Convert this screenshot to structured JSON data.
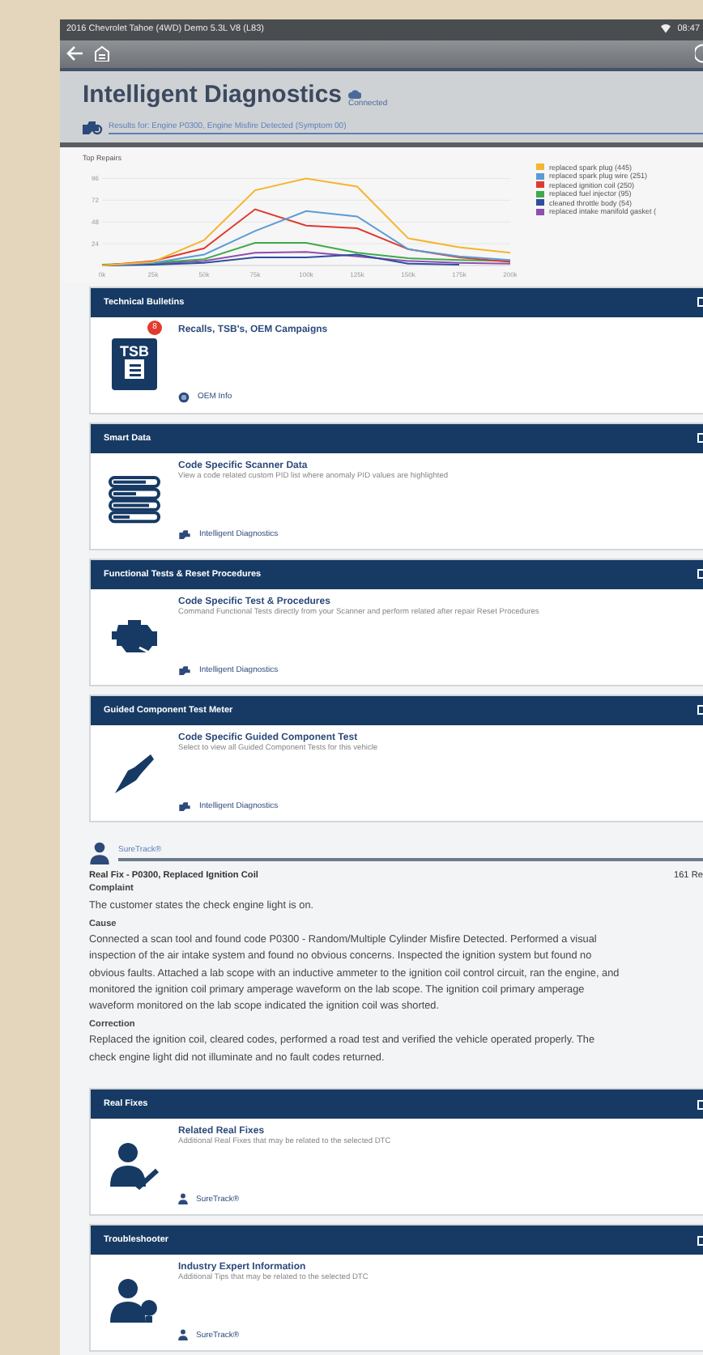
{
  "status_bar": {
    "vehicle": "2016 Chevrolet Tahoe (4WD) Demo 5.3L V8 (L83)",
    "time": "08:47"
  },
  "header": {
    "title": "Intelligent Diagnostics",
    "status": "Connected",
    "results": "Results for: Engine P0300, Engine Misfire Detected (Symptom 00)"
  },
  "chart_data": {
    "type": "line",
    "title": "Top Repairs",
    "categories": [
      "0k",
      "25k",
      "50k",
      "75k",
      "100k",
      "125k",
      "150k",
      "175k",
      "200k"
    ],
    "yticks": [
      24,
      48,
      72,
      96
    ],
    "ylim": [
      0,
      100
    ],
    "grid": true,
    "series": [
      {
        "name": "replaced spark plug (445)",
        "color": "#f5b52e",
        "values": [
          0,
          4,
          28,
          83,
          96,
          87,
          30,
          20,
          14
        ]
      },
      {
        "name": "replaced spark plug wire (251)",
        "color": "#5b9bd5",
        "values": [
          0,
          3,
          12,
          38,
          60,
          54,
          18,
          10,
          6
        ]
      },
      {
        "name": "replaced ignition coil (250)",
        "color": "#e03a2f",
        "values": [
          0,
          5,
          19,
          62,
          44,
          41,
          18,
          9,
          4
        ]
      },
      {
        "name": "replaced fuel injector (95)",
        "color": "#3fa94a",
        "values": [
          1,
          3,
          7,
          25,
          25,
          14,
          8,
          6,
          5
        ]
      },
      {
        "name": "cleaned throttle body (54)",
        "color": "#2f4ea0",
        "values": [
          0,
          1,
          3,
          9,
          9,
          12,
          2,
          1,
          null
        ]
      },
      {
        "name": "replaced intake manifold gasket (",
        "color": "#8e4fb0",
        "values": [
          0,
          2,
          5,
          14,
          15,
          10,
          5,
          3,
          2
        ]
      }
    ]
  },
  "sections": [
    {
      "title": "Technical Bulletins",
      "kind": "tsb",
      "icon_label": "TSB",
      "badge": "8",
      "item_title": "Recalls, TSB's, OEM Campaigns",
      "link": {
        "kind": "globe",
        "label": "OEM Info"
      }
    },
    {
      "title": "Smart Data",
      "kind": "data",
      "item_title": "Code Specific Scanner Data",
      "description": "View a code related custom PID list where anomaly PID values are highlighted",
      "link": {
        "kind": "diag",
        "label": "Intelligent Diagnostics"
      }
    },
    {
      "title": "Functional Tests & Reset Procedures",
      "kind": "engine",
      "item_title": "Code Specific Test & Procedures",
      "description": "Command Functional Tests directly from your Scanner and perform related after repair Reset Procedures",
      "link": {
        "kind": "diag",
        "label": "Intelligent Diagnostics"
      }
    },
    {
      "title": "Guided Component Test Meter",
      "kind": "probe",
      "item_title": "Code Specific Guided Component Test",
      "description": "Select to view all Guided Component Tests for this vehicle",
      "link": {
        "kind": "diag",
        "label": "Intelligent Diagnostics"
      }
    }
  ],
  "suretrack": {
    "brand": "SureTrack®",
    "fix_title": "Real Fix - P0300, Replaced Ignition Coil",
    "count": "161 Re",
    "blocks": [
      {
        "heading": "Complaint",
        "text": "The customer states the check engine light is on."
      },
      {
        "heading": "Cause",
        "text": "Connected a scan tool and found code P0300 - Random/Multiple Cylinder Misfire Detected. Performed a visual inspection of the air intake system and found no obvious concerns. Inspected the ignition system but found no obvious faults. Attached a lab scope with an inductive ammeter to the ignition coil control circuit, ran the engine, and monitored the ignition coil primary amperage waveform on the lab scope. The ignition coil primary amperage waveform monitored on the lab scope indicated the ignition coil was shorted."
      },
      {
        "heading": "Correction",
        "text": "Replaced the ignition coil, cleared codes, performed a road test and verified the vehicle operated properly. The check engine light did not illuminate and no fault codes returned."
      }
    ]
  },
  "more_sections": [
    {
      "title": "Real Fixes",
      "kind": "fixes",
      "item_title": "Related Real Fixes",
      "description": "Additional Real Fixes that may be related to the selected DTC",
      "link": {
        "kind": "suretrack",
        "label": "SureTrack®"
      }
    },
    {
      "title": "Troubleshooter",
      "kind": "expert",
      "item_title": "Industry Expert Information",
      "description": "Additional Tips that may be related to the selected DTC",
      "link": {
        "kind": "suretrack",
        "label": "SureTrack®"
      }
    }
  ]
}
